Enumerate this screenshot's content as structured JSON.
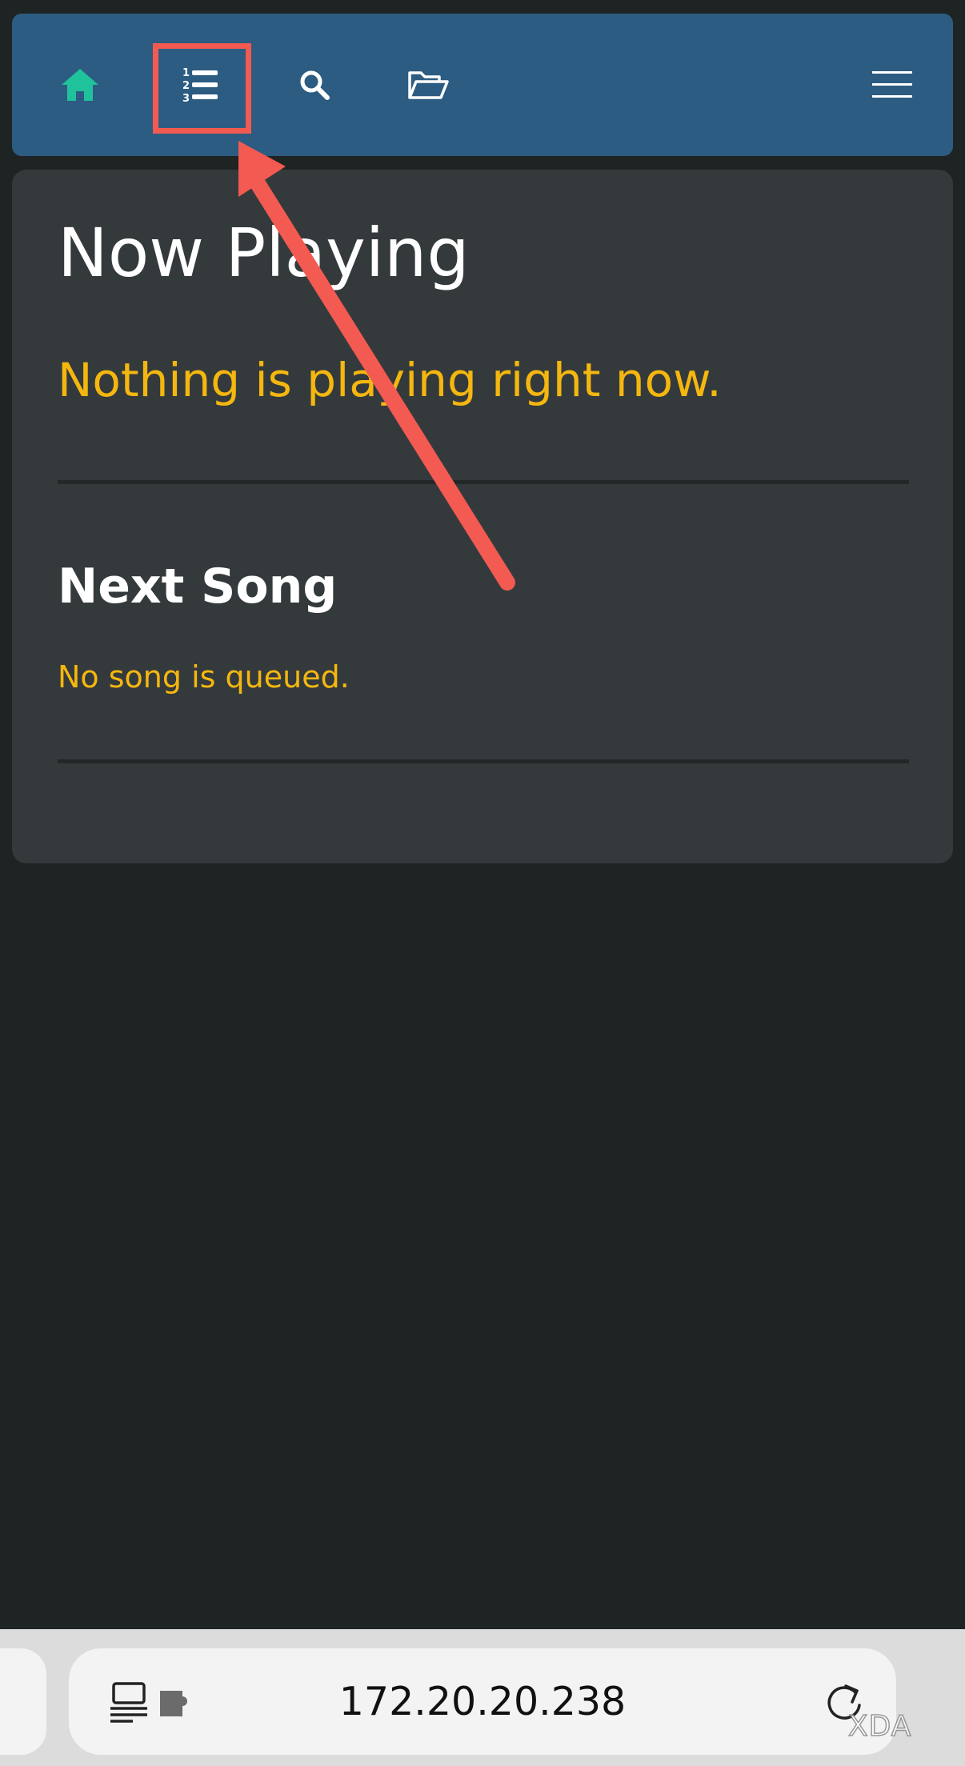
{
  "navbar": {
    "background_color": "#2c5c82",
    "items": [
      {
        "icon": "home-icon",
        "color": "#1fc29b"
      },
      {
        "icon": "numbered-list-icon",
        "color": "#ffffff",
        "highlighted": true
      },
      {
        "icon": "search-icon",
        "color": "#ffffff"
      },
      {
        "icon": "folder-open-icon",
        "color": "#ffffff"
      },
      {
        "icon": "hamburger-menu-icon",
        "color": "#ffffff"
      }
    ]
  },
  "now_playing": {
    "title": "Now Playing",
    "status": "Nothing is playing right now."
  },
  "next_song": {
    "title": "Next Song",
    "status": "No song is queued."
  },
  "browser": {
    "url": "172.20.20.238",
    "left_icons": [
      "reader-mode-icon",
      "extensions-puzzle-icon"
    ],
    "right_icon": "reload-icon"
  },
  "watermark": "XDA",
  "colors": {
    "page_background": "#1e2323",
    "card_background": "#343a3c",
    "accent_text": "#f5b70f",
    "annotation": "#f25a52"
  }
}
